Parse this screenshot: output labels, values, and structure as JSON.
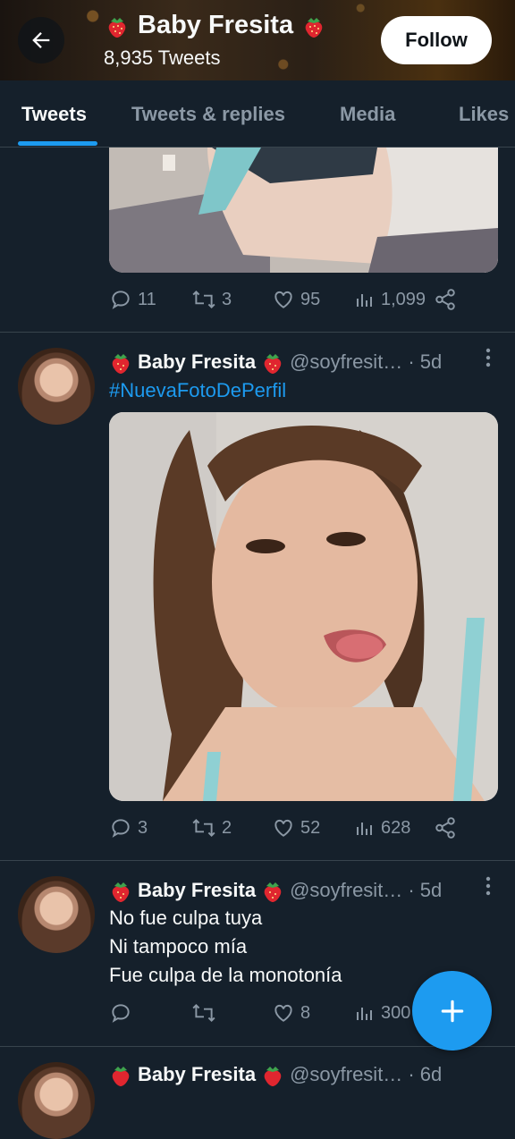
{
  "header": {
    "name": "Baby Fresita",
    "tweet_count": "8,935 Tweets",
    "follow_label": "Follow"
  },
  "tabs": [
    "Tweets",
    "Tweets & replies",
    "Media",
    "Likes"
  ],
  "tweets": [
    {
      "stats": {
        "replies": "11",
        "retweets": "3",
        "likes": "95",
        "views": "1,099"
      }
    },
    {
      "name": "Baby Fresita",
      "handle": "@soyfresit…",
      "time": "· 5d",
      "hashtag": "#NuevaFotoDePerfil",
      "stats": {
        "replies": "3",
        "retweets": "2",
        "likes": "52",
        "views": "628"
      }
    },
    {
      "name": "Baby Fresita",
      "handle": "@soyfresit…",
      "time": "· 5d",
      "lines": [
        "No fue culpa tuya",
        "Ni tampoco mía",
        "Fue culpa de la monotonía"
      ],
      "stats": {
        "replies": "",
        "retweets": "",
        "likes": "8",
        "views": "300"
      }
    },
    {
      "name": "Baby Fresita",
      "handle": "@soyfresit…",
      "time": "· 6d"
    }
  ],
  "colors": {
    "accent": "#1d9bf0",
    "background": "#15202b",
    "muted": "#8b98a5"
  }
}
